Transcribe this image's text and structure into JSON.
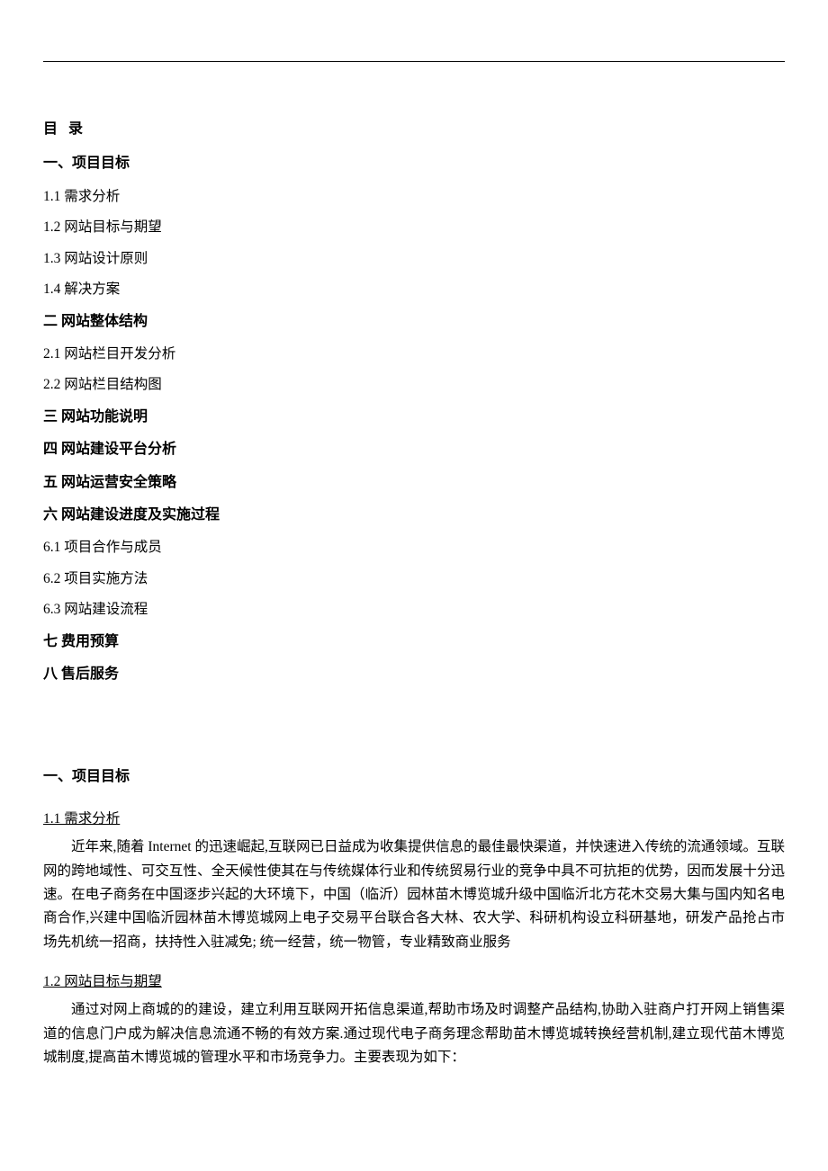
{
  "toc": {
    "heading": "目 录",
    "s1": "一、项目目标",
    "s1_1": "1.1  需求分析",
    "s1_2": "1.2  网站目标与期望",
    "s1_3": "1.3  网站设计原则",
    "s1_4": "1.4 解决方案",
    "s2": "二  网站整体结构",
    "s2_1": "2.1  网站栏目开发分析",
    "s2_2": "2.2  网站栏目结构图",
    "s3": "三  网站功能说明",
    "s4": "四  网站建设平台分析",
    "s5": "五  网站运营安全策略",
    "s6": "六  网站建设进度及实施过程",
    "s6_1": "6.1  项目合作与成员",
    "s6_2": "6.2  项目实施方法",
    "s6_3": "6.3  网站建设流程",
    "s7": "七  费用预算",
    "s8": "八  售后服务"
  },
  "body": {
    "h1": "一、项目目标",
    "sub1_1": "1.1  需求分析",
    "p1_1": "近年来,随着 Internet 的迅速崛起,互联网已日益成为收集提供信息的最佳最快渠道，并快速进入传统的流通领域。互联网的跨地域性、可交互性、全天候性使其在与传统媒体行业和传统贸易行业的竞争中具不可抗拒的优势，因而发展十分迅速。在电子商务在中国逐步兴起的大环境下，中国（临沂）园林苗木博览城升级中国临沂北方花木交易大集与国内知名电商合作,兴建中国临沂园林苗木博览城网上电子交易平台联合各大林、农大学、科研机构设立科研基地，研发产品抢占市场先机统一招商，扶持性入驻减免; 统一经营，统一物管，专业精致商业服务",
    "sub1_2": "1.2  网站目标与期望",
    "p1_2": "通过对网上商城的的建设，建立利用互联网开拓信息渠道,帮助市场及时调整产品结构,协助入驻商户打开网上销售渠道的信息门户成为解决信息流通不畅的有效方案.通过现代电子商务理念帮助苗木博览城转换经营机制,建立现代苗木博览城制度,提高苗木博览城的管理水平和市场竞争力。主要表现为如下："
  }
}
